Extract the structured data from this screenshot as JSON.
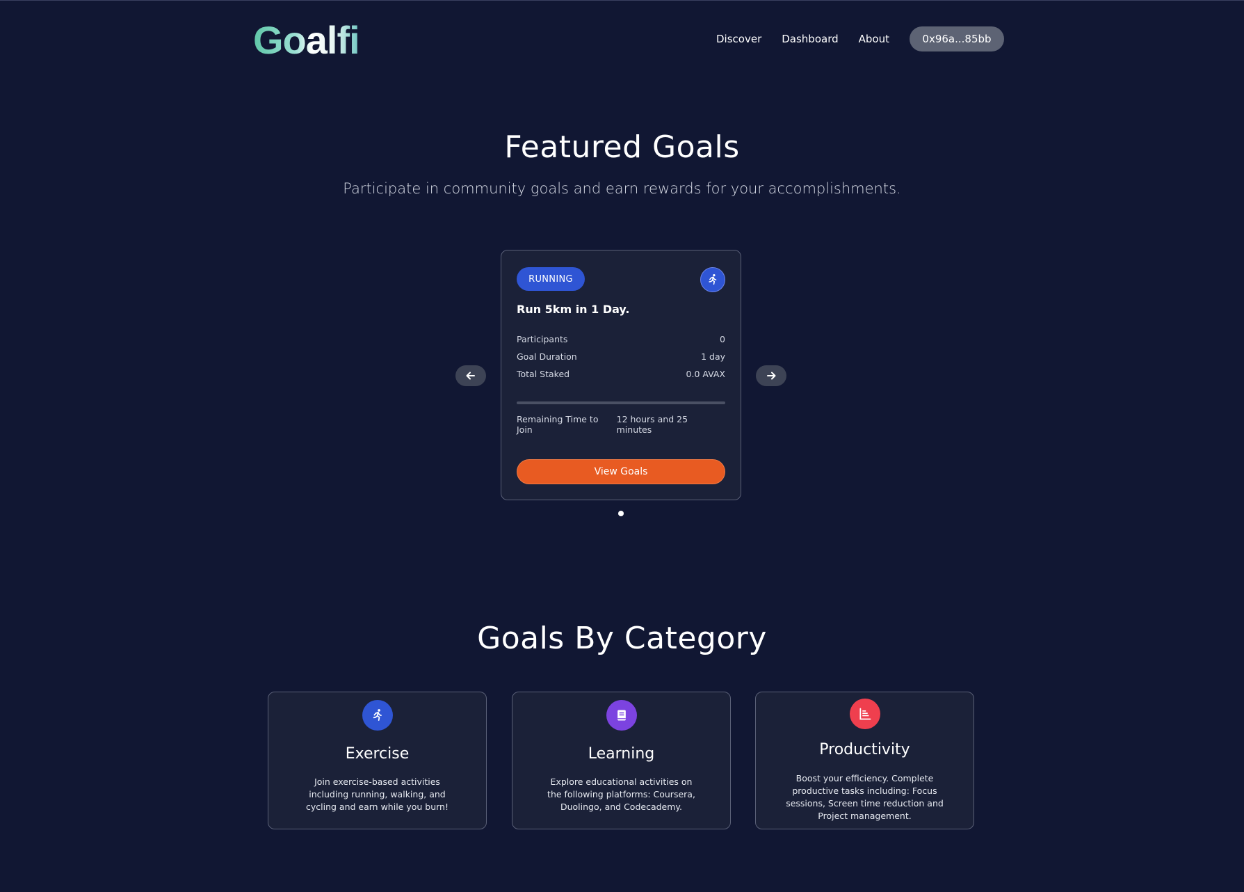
{
  "brand": {
    "logo_text": "Goalfi"
  },
  "nav": {
    "links": [
      "Discover",
      "Dashboard",
      "About"
    ],
    "wallet_label": "0x96a...85bb"
  },
  "featured": {
    "title": "Featured Goals",
    "subtitle": "Participate in community goals and earn rewards for your accomplishments."
  },
  "goal_card": {
    "tag": "RUNNING",
    "icon": "running-icon",
    "title": "Run 5km in 1 Day.",
    "stats": [
      {
        "label": "Participants",
        "value": "0"
      },
      {
        "label": "Goal Duration",
        "value": "1 day"
      },
      {
        "label": "Total Staked",
        "value": "0.0 AVAX"
      }
    ],
    "progress_fraction": 0,
    "remaining_label": "Remaining Time to Join",
    "remaining_value": "12 hours and 25 minutes",
    "button_label": "View Goals"
  },
  "categories": {
    "title": "Goals By Category",
    "items": [
      {
        "name": "Exercise",
        "icon": "running-icon",
        "color": "#2f55d4",
        "description": "Join exercise-based activities including running, walking, and cycling and earn while you burn!"
      },
      {
        "name": "Learning",
        "icon": "book-icon",
        "color": "#7c43e0",
        "description": "Explore educational activities on the following platforms: Coursera, Duolingo, and Codecademy."
      },
      {
        "name": "Productivity",
        "icon": "chart-icon",
        "color": "#ef3f4e",
        "description": "Boost your efficiency. Complete productive tasks including: Focus sessions, Screen time reduction and Project management."
      }
    ]
  },
  "colors": {
    "background": "#111733",
    "card": "#1b2138",
    "accent_blue": "#2f55d4",
    "accent_orange": "#e85b22"
  }
}
